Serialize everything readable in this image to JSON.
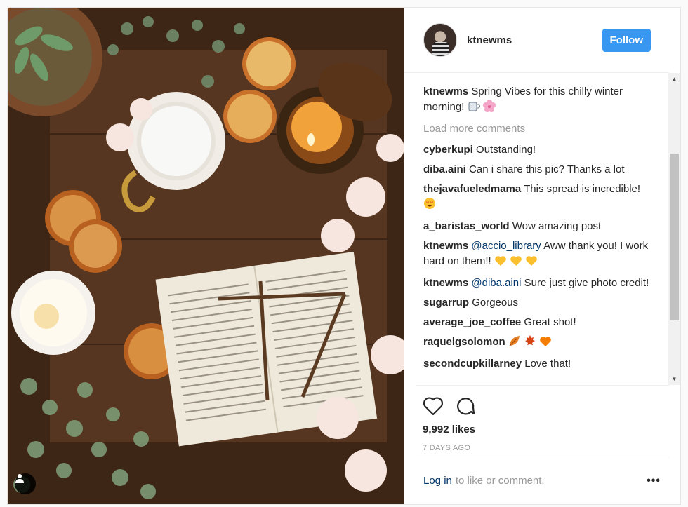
{
  "header": {
    "username": "ktnewms",
    "follow_label": "Follow"
  },
  "caption": {
    "author": "ktnewms",
    "text": "Spring Vibes for this chilly winter morning! ",
    "emojis": [
      "coffee-cup-emoji",
      "cherry-blossom-emoji"
    ]
  },
  "load_more": "Load more comments",
  "comments": [
    {
      "author": "cyberkupi",
      "mention": "",
      "text": "Outstanding!"
    },
    {
      "author": "diba.aini",
      "mention": "",
      "text": "Can i share this pic? Thanks a lot"
    },
    {
      "author": "thejavafueledmama",
      "mention": "",
      "text": "This spread is incredible! "
    },
    {
      "author": "a_baristas_world",
      "mention": "",
      "text": "Wow amazing post"
    },
    {
      "author": "ktnewms",
      "mention": "@accio_library",
      "text": " Aww thank you! I work hard on them!! "
    },
    {
      "author": "ktnewms",
      "mention": "@diba.aini",
      "text": " Sure just give photo credit!"
    },
    {
      "author": "sugarrup",
      "mention": "",
      "text": "Gorgeous"
    },
    {
      "author": "average_joe_coffee",
      "mention": "",
      "text": "Great shot!"
    },
    {
      "author": "raquelgsolomon",
      "mention": "",
      "text": ""
    },
    {
      "author": "secondcupkillarney",
      "mention": "",
      "text": "Love that!"
    }
  ],
  "actions": {
    "like_icon": "heart-icon",
    "comment_icon": "comment-icon"
  },
  "likes": "9,992 likes",
  "date": "7 DAYS AGO",
  "footer": {
    "login_label": "Log in",
    "rest": "to like or comment.",
    "more_label": "•••"
  },
  "colors": {
    "accent": "#3897f0",
    "link": "#003569",
    "muted": "#999999"
  }
}
